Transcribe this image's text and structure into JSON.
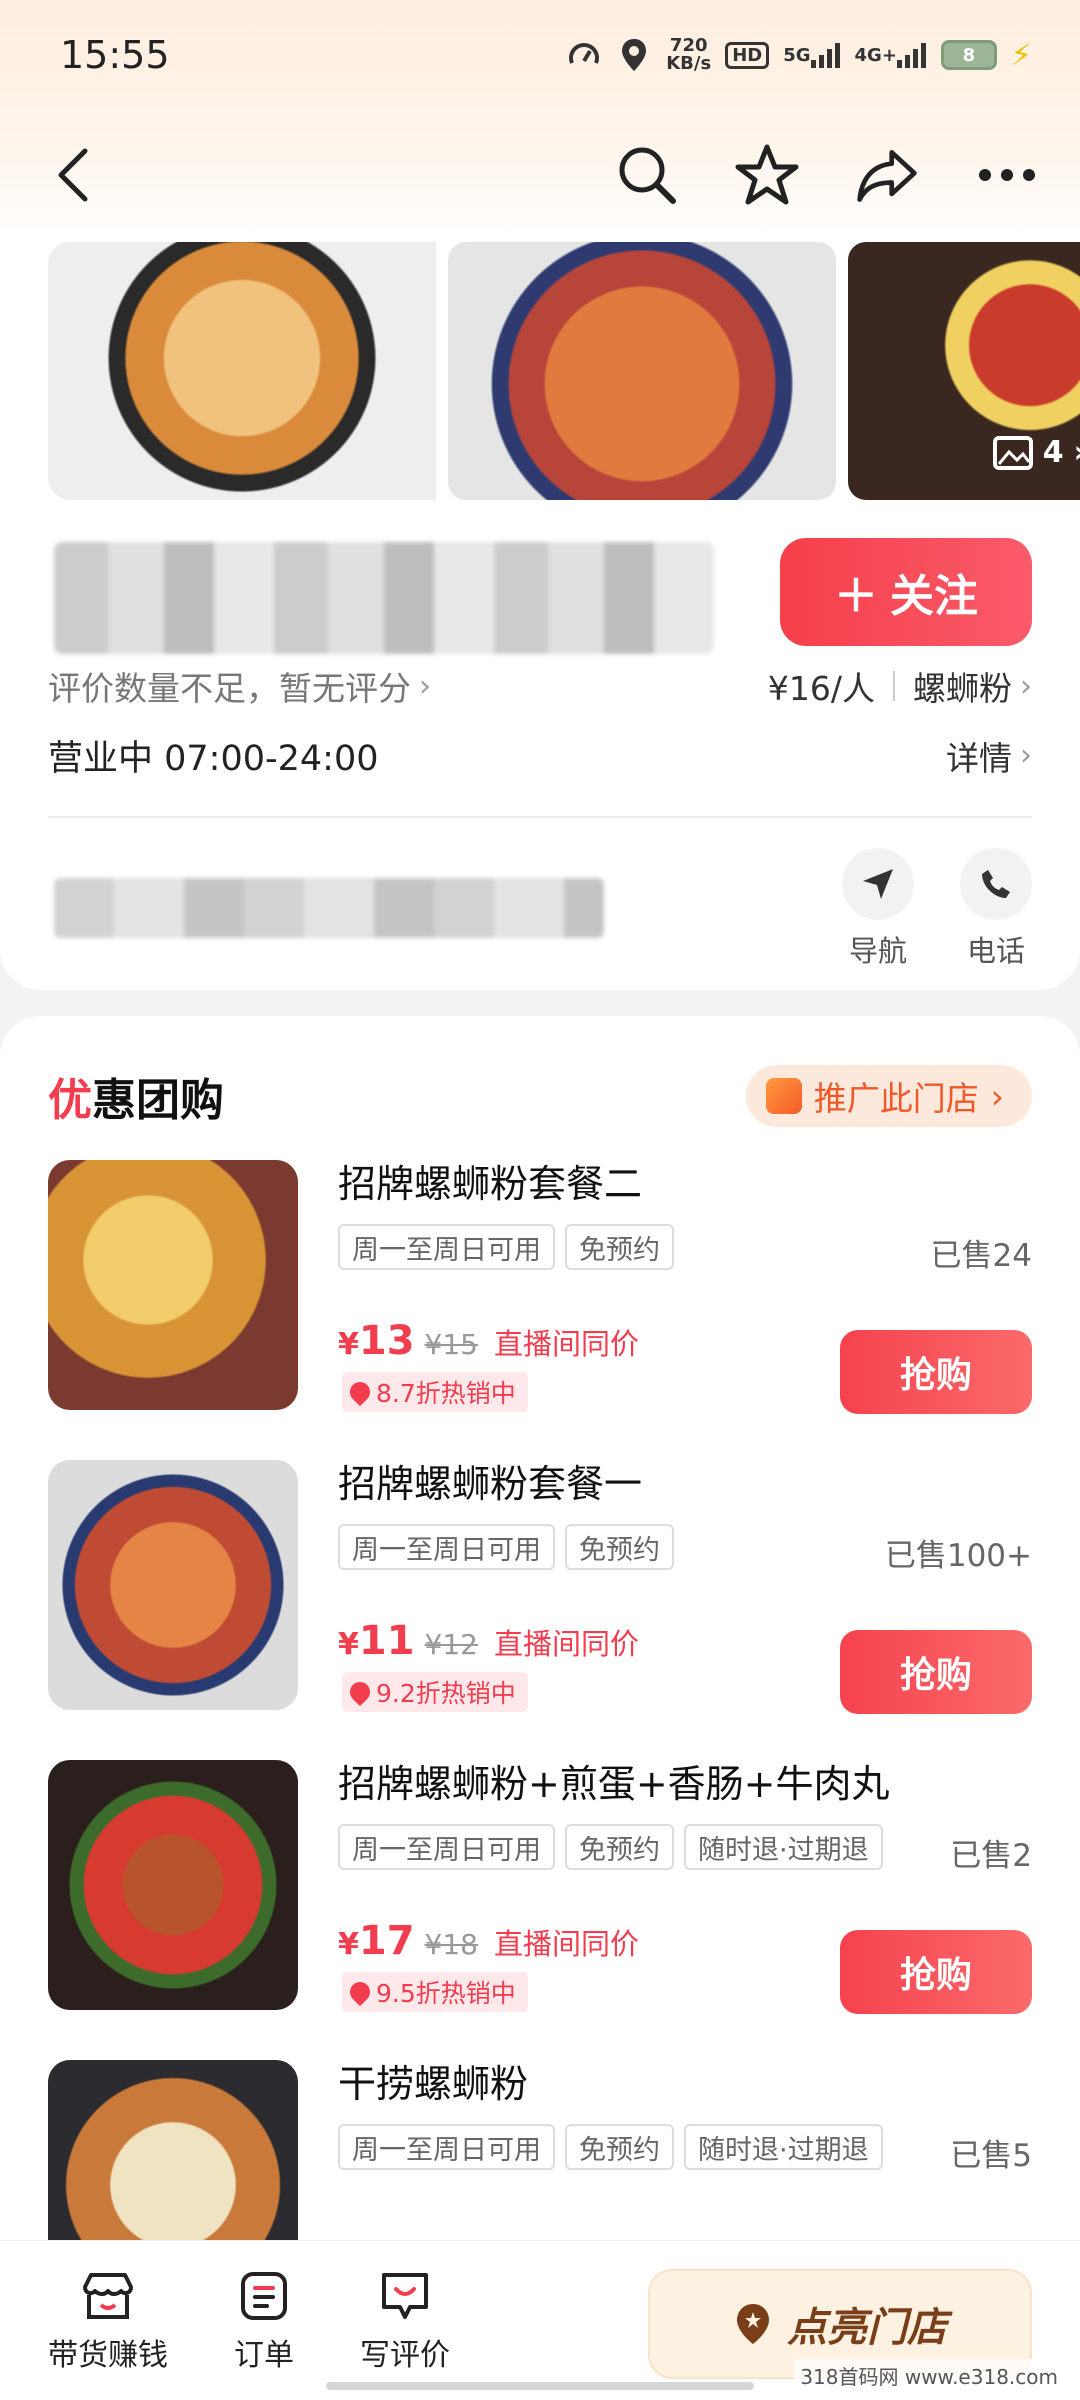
{
  "status_bar": {
    "time": "15:55",
    "speed_value": "720",
    "speed_unit": "KB/s",
    "hd": "HD",
    "net5g": "5G",
    "net4g": "4G+",
    "battery": "8"
  },
  "gallery": {
    "photo_count": "4"
  },
  "shop": {
    "follow_label": "关注",
    "rating_text": "评价数量不足，暂无评分",
    "price_per_person": "¥16/人",
    "category": "螺蛳粉",
    "hours": "营业中 07:00-24:00",
    "detail_label": "详情",
    "nav_label": "导航",
    "phone_label": "电话"
  },
  "deals": {
    "title_first": "优",
    "title_rest": "惠团购",
    "promote_label": "推广此门店",
    "buy_label": "抢购",
    "items": [
      {
        "name": "招牌螺蛳粉套餐二",
        "tags": [
          "周一至周日可用",
          "免预约"
        ],
        "sold": "已售24",
        "price": "13",
        "original": "¥15",
        "live": "直播间同价",
        "discount": "8.7折热销中"
      },
      {
        "name": "招牌螺蛳粉套餐一",
        "tags": [
          "周一至周日可用",
          "免预约"
        ],
        "sold": "已售100+",
        "price": "11",
        "original": "¥12",
        "live": "直播间同价",
        "discount": "9.2折热销中"
      },
      {
        "name": "招牌螺蛳粉+煎蛋+香肠+牛肉丸",
        "tags": [
          "周一至周日可用",
          "免预约",
          "随时退·过期退"
        ],
        "sold": "已售2",
        "price": "17",
        "original": "¥18",
        "live": "直播间同价",
        "discount": "9.5折热销中"
      },
      {
        "name": "干捞螺蛳粉",
        "tags": [
          "周一至周日可用",
          "免预约",
          "随时退·过期退"
        ],
        "sold": "已售5"
      }
    ],
    "currency": "¥"
  },
  "bottom_bar": {
    "tab_earn": "带货赚钱",
    "tab_orders": "订单",
    "tab_review": "写评价",
    "light_label": "点亮门店"
  },
  "watermark": "318首码网 www.e318.com",
  "colors": {
    "accent": "#f23d4f",
    "promote": "#f0582a"
  }
}
